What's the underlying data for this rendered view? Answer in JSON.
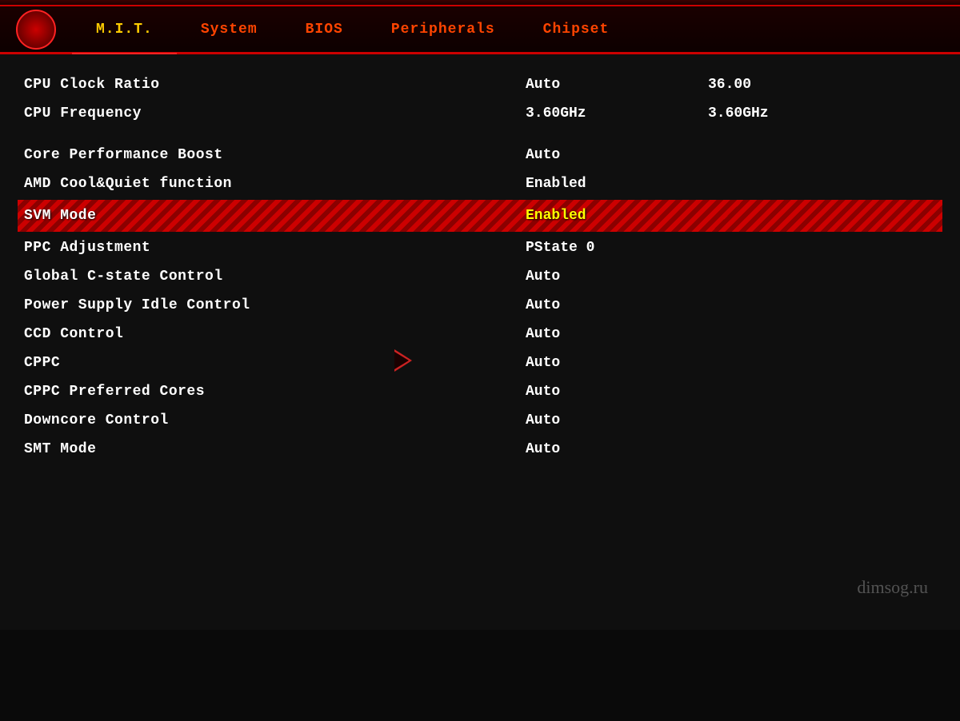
{
  "tabs": [
    {
      "id": "mit",
      "label": "M.I.T.",
      "active": true
    },
    {
      "id": "system",
      "label": "System",
      "active": false
    },
    {
      "id": "bios",
      "label": "BIOS",
      "active": false
    },
    {
      "id": "peripherals",
      "label": "Peripherals",
      "active": false
    },
    {
      "id": "chipset",
      "label": "Chipset",
      "active": false
    }
  ],
  "settings": [
    {
      "group": "cpu",
      "rows": [
        {
          "name": "CPU Clock Ratio",
          "value": "Auto",
          "value2": "36.00",
          "highlighted": false
        },
        {
          "name": "CPU Frequency",
          "value": "3.60GHz",
          "value2": "3.60GHz",
          "highlighted": false
        }
      ]
    },
    {
      "group": "performance",
      "rows": [
        {
          "name": "Core Performance Boost",
          "value": "Auto",
          "value2": "",
          "highlighted": false
        },
        {
          "name": "AMD Cool&Quiet function",
          "value": "Enabled",
          "value2": "",
          "highlighted": false
        },
        {
          "name": "SVM Mode",
          "value": "Enabled",
          "value2": "",
          "highlighted": true
        },
        {
          "name": "PPC Adjustment",
          "value": "PState 0",
          "value2": "",
          "highlighted": false
        },
        {
          "name": "Global C-state Control",
          "value": "Auto",
          "value2": "",
          "highlighted": false
        },
        {
          "name": "Power Supply Idle Control",
          "value": "Auto",
          "value2": "",
          "highlighted": false
        },
        {
          "name": "CCD Control",
          "value": "Auto",
          "value2": "",
          "highlighted": false
        },
        {
          "name": "CPPC",
          "value": "Auto",
          "value2": "",
          "highlighted": false
        },
        {
          "name": "CPPC Preferred Cores",
          "value": "Auto",
          "value2": "",
          "highlighted": false
        },
        {
          "name": "Downcore Control",
          "value": "Auto",
          "value2": "",
          "highlighted": false
        },
        {
          "name": "SMT Mode",
          "value": "Auto",
          "value2": "",
          "highlighted": false
        }
      ]
    }
  ],
  "watermark": "dimsog.ru"
}
